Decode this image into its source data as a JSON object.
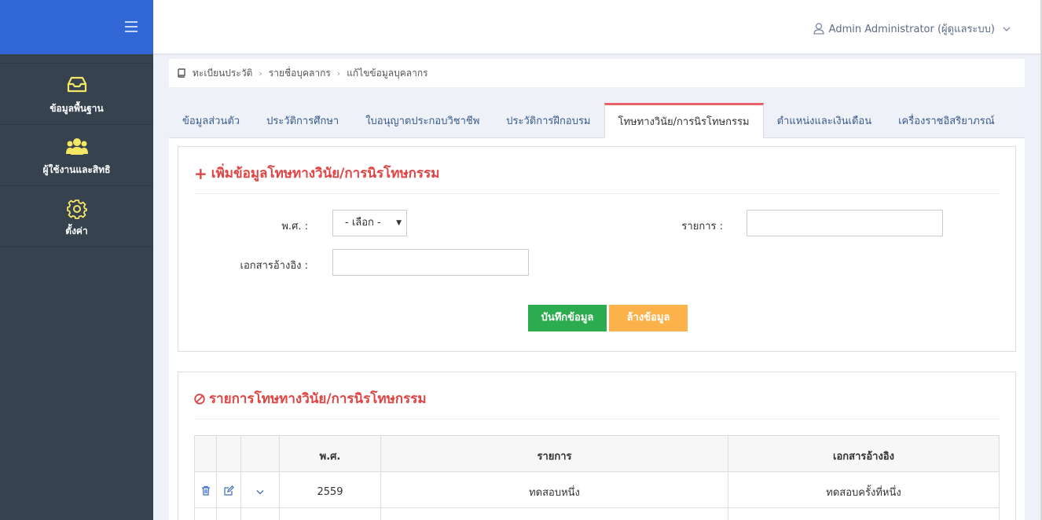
{
  "header": {
    "user_label": "Admin Administrator (ผู้ดูแลระบบ)"
  },
  "sidebar": {
    "items": [
      {
        "label": "ข้อมูลพื้นฐาน",
        "icon": "inbox-icon"
      },
      {
        "label": "ผู้ใช้งานและสิทธิ",
        "icon": "users-icon"
      },
      {
        "label": "ตั้งค่า",
        "icon": "gear-icon"
      }
    ]
  },
  "breadcrumb": [
    "ทะเบียนประวัติ",
    "รายชื่อบุคลากร",
    "แก้ไขข้อมูลบุคลากร"
  ],
  "tabs": [
    {
      "label": "ข้อมูลส่วนตัว"
    },
    {
      "label": "ประวัติการศึกษา"
    },
    {
      "label": "ใบอนุญาตประกอบวิชาชีพ"
    },
    {
      "label": "ประวัติการฝึกอบรม"
    },
    {
      "label": "โทษทางวินัย/การนิรโทษกรรม"
    },
    {
      "label": "ตำแหน่งและเงินเดือน"
    },
    {
      "label": "เครื่องราชอิสริยาภรณ์"
    }
  ],
  "form": {
    "title": "เพิ่มข้อมูลโทษทางวินัย/การนิรโทษกรรม",
    "year_label": "พ.ศ. :",
    "year_value": "- เลือก -",
    "item_label": "รายการ :",
    "item_value": "",
    "ref_label": "เอกสารอ้างอิง :",
    "ref_value": "",
    "save_label": "บันทึกข้อมูล",
    "clear_label": "ล้างข้อมูล"
  },
  "list": {
    "title": "รายการโทษทางวินัย/การนิรโทษกรรม",
    "columns": [
      "พ.ศ.",
      "รายการ",
      "เอกสารอ้างอิง"
    ],
    "rows": [
      {
        "year": "2559",
        "item": "ทดสอบหนึ่ง",
        "ref": "ทดสอบครั้งที่หนึ่ง"
      },
      {
        "year": "",
        "item": "",
        "ref": ""
      }
    ]
  },
  "colors": {
    "sidebar_top": "#3267d6",
    "sidebar_bg": "#36434f",
    "icon_yellow": "#f5e663",
    "title_red": "#e04343",
    "save_green": "#2cac4e",
    "clear_orange": "#fbb24a"
  }
}
